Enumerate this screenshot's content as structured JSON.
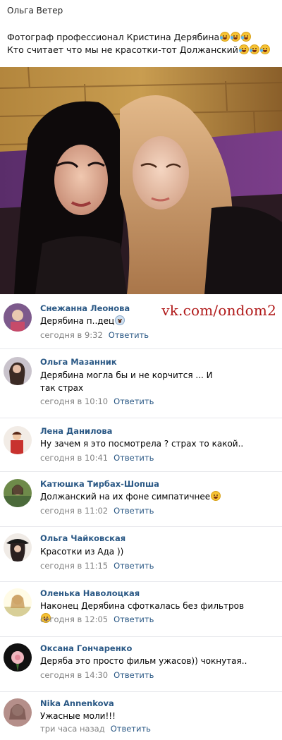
{
  "post": {
    "author": "Ольга Ветер",
    "lines": [
      {
        "text": "Фотограф профессионал Кристина Дерябина",
        "emoji": [
          "tear",
          "tear",
          "tear"
        ]
      },
      {
        "text": "Кто считает что мы не красотки-тот Должанский",
        "emoji": [
          "tear",
          "tear",
          "tear"
        ]
      }
    ]
  },
  "watermark": "vk.com/ondom2",
  "reply_label": "Ответить",
  "comments": [
    {
      "name": "Снежанна Леонова",
      "text": "Дерябина п..дец",
      "emoji": "scream",
      "time": "сегодня в 9:32",
      "avatar_colors": [
        "#7d5a8c",
        "#e8c9b0"
      ]
    },
    {
      "name": "Ольга Мазанник",
      "text": "Дерябина могла бы и не корчится ... И так страх",
      "time": "сегодня в 10:10",
      "avatar_colors": [
        "#c9c3cc",
        "#3b2a24"
      ]
    },
    {
      "name": "Лена Данилова",
      "text": "Ну зачем я это посмотрела ? страх то какой..",
      "time": "сегодня в 10:41",
      "avatar_colors": [
        "#c8322e",
        "#f1c8a6"
      ]
    },
    {
      "name": "Катюшка Тирбах-Шопша",
      "text": "Должанский на их фоне симпатичнее",
      "emoji": "smile",
      "time": "сегодня в 11:02",
      "avatar_colors": [
        "#6e8a4a",
        "#3a2a1e"
      ]
    },
    {
      "name": "Ольга Чайковская",
      "text": "Красотки из Ада ))",
      "time": "сегодня в 11:15",
      "avatar_colors": [
        "#f0ebe6",
        "#1a1a1a"
      ]
    },
    {
      "name": "Оленька Наволоцкая",
      "text": "Наконец Дерябина сфоткалась без фильтров",
      "emoji": "tear",
      "time": "сегодня в 12:05",
      "avatar_colors": [
        "#d8cf98",
        "#fffbe6"
      ]
    },
    {
      "name": "Оксана Гончаренко",
      "text": "Деряба это просто фильм ужасов)) чокнутая..",
      "time": "сегодня в 14:30",
      "avatar_colors": [
        "#111111",
        "#f0b8c0"
      ]
    },
    {
      "name": "Nika Annenkova",
      "text": "Ужасные моли!!!",
      "time": "три часа назад",
      "avatar_colors": [
        "#b58f8a",
        "#e9cfc6"
      ]
    }
  ]
}
